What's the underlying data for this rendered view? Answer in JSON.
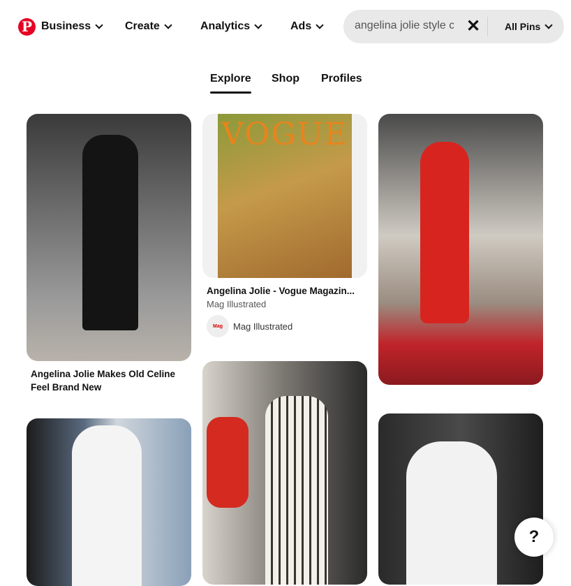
{
  "nav": {
    "brand": "P",
    "menus": [
      {
        "label": "Business"
      },
      {
        "label": "Create"
      },
      {
        "label": "Analytics"
      },
      {
        "label": "Ads"
      }
    ],
    "search": {
      "value": "angelina jolie style c",
      "scope": "All Pins"
    }
  },
  "tabs": [
    {
      "label": "Explore",
      "active": true
    },
    {
      "label": "Shop"
    },
    {
      "label": "Profiles"
    }
  ],
  "pins": [
    {
      "title": "Angelina Jolie Makes Old Celine Feel Brand New"
    },
    {
      "title": "Angelina Jolie - Vogue Magazin...",
      "subtitle": "Mag Illustrated",
      "owner": "Mag Illustrated",
      "owner_avatar": "Mag Illustrated",
      "cover_text": "VOGUE"
    },
    {},
    {},
    {},
    {}
  ],
  "help": "?",
  "colors": {
    "brand": "#e60023"
  }
}
